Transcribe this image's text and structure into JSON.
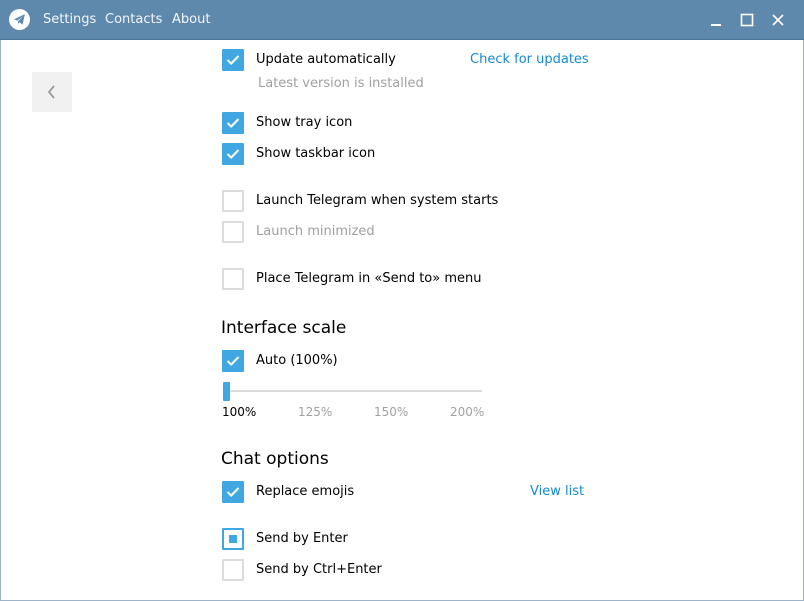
{
  "menu": {
    "settings": "Settings",
    "contacts": "Contacts",
    "about": "About"
  },
  "window_controls": {
    "minimize_icon": "minimize-icon",
    "maximize_icon": "maximize-icon",
    "close_icon": "close-icon"
  },
  "general": {
    "update_automatically": {
      "label": "Update automatically",
      "checked": true
    },
    "check_for_updates": "Check for updates",
    "version_status": "Latest version is installed",
    "show_tray_icon": {
      "label": "Show tray icon",
      "checked": true
    },
    "show_taskbar_icon": {
      "label": "Show taskbar icon",
      "checked": true
    },
    "launch_on_start": {
      "label": "Launch Telegram when system starts",
      "checked": false
    },
    "launch_minimized": {
      "label": "Launch minimized",
      "checked": false,
      "disabled": true
    },
    "send_to_menu": {
      "label": "Place Telegram in «Send to» menu",
      "checked": false
    }
  },
  "interface_scale": {
    "title": "Interface scale",
    "auto": {
      "label": "Auto (100%)",
      "checked": true
    },
    "options": [
      "100%",
      "125%",
      "150%",
      "200%"
    ],
    "selected": "100%"
  },
  "chat_options": {
    "title": "Chat options",
    "replace_emojis": {
      "label": "Replace emojis",
      "checked": true
    },
    "view_list": "View list",
    "send_by_enter": {
      "label": "Send by Enter",
      "selected": true
    },
    "send_by_ctrl_enter": {
      "label": "Send by Ctrl+Enter",
      "selected": false
    }
  },
  "colors": {
    "titlebar": "#5f88ad",
    "accent": "#40a7e3",
    "link": "#168acd"
  }
}
